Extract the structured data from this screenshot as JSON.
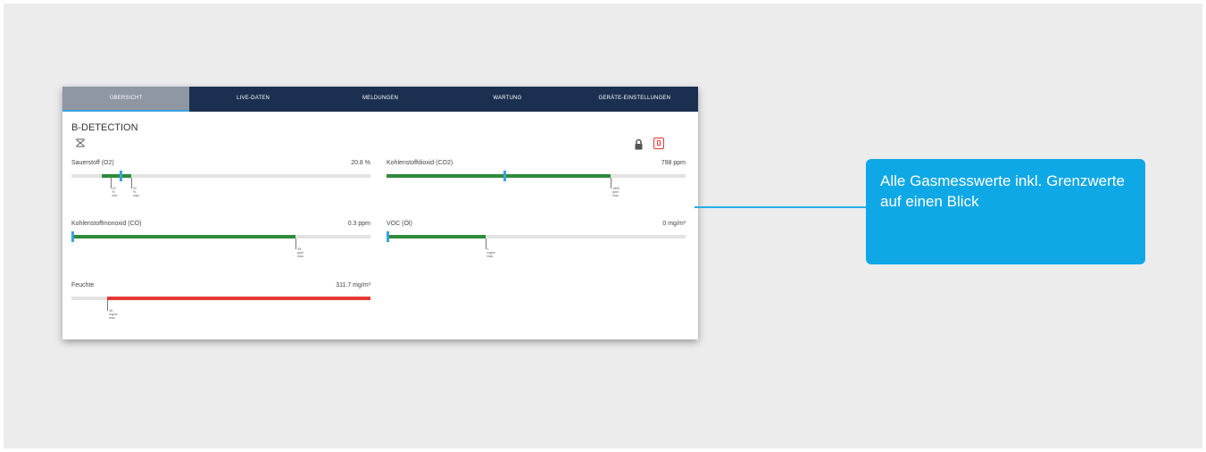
{
  "tabs": [
    {
      "label": "ÜBERSICHT",
      "active": true
    },
    {
      "label": "LIVE-DATEN",
      "active": false
    },
    {
      "label": "MELDUNGEN",
      "active": false
    },
    {
      "label": "WARTUNG",
      "active": false
    },
    {
      "label": "GERÄTE-EINSTELLUNGEN",
      "active": false
    }
  ],
  "device": {
    "title": "B-DETECTION"
  },
  "icons": {
    "sensor": "sensor-icon",
    "lock": "lock-icon",
    "alarm": "alarm-icon"
  },
  "colors": {
    "nav": "#1b3050",
    "ok": "#2e8b3a",
    "alarm": "#e53935",
    "marker": "#3aa3dd",
    "callout": "#0fa8e6"
  },
  "gauges": [
    {
      "label": "Sauerstoff (O2)",
      "value": "20.8 %",
      "level_pct": 16,
      "bar_from_pct": 10,
      "bar_to_pct": 20,
      "status": "ok",
      "thresholds": [
        {
          "pos_pct": 13,
          "lines": [
            "23",
            "%",
            "min."
          ]
        },
        {
          "pos_pct": 20,
          "lines": [
            "22",
            "%",
            "max."
          ]
        }
      ]
    },
    {
      "label": "Kohlenstoffdioxid (CO2)",
      "value": "798 ppm",
      "level_pct": 39,
      "bar_from_pct": 0,
      "bar_to_pct": 75,
      "status": "ok",
      "thresholds": [
        {
          "pos_pct": 75,
          "lines": [
            "1500",
            "ppm",
            "max."
          ]
        }
      ]
    },
    {
      "label": "Kohlenstoffmonoxid (CO)",
      "value": "0.3 ppm",
      "level_pct": 0,
      "bar_from_pct": 0,
      "bar_to_pct": 75,
      "status": "ok",
      "thresholds": [
        {
          "pos_pct": 75,
          "lines": [
            "35",
            "ppm",
            "max."
          ]
        }
      ]
    },
    {
      "label": "VOC (Öl)",
      "value": "0 mg/m³",
      "level_pct": 0,
      "bar_from_pct": 0,
      "bar_to_pct": 33,
      "status": "ok",
      "thresholds": [
        {
          "pos_pct": 33,
          "lines": [
            "1",
            "mg/m³",
            "max."
          ]
        }
      ]
    },
    {
      "label": "Feuchte",
      "value": "311.7 mg/m³",
      "level_pct": 100,
      "bar_from_pct": 12,
      "bar_to_pct": 100,
      "status": "alarm",
      "thresholds": [
        {
          "pos_pct": 12,
          "lines": [
            "25",
            "mg/m³",
            "max."
          ]
        }
      ]
    }
  ],
  "callout": {
    "text": "Alle Gasmesswerte inkl. Grenzwerte auf einen Blick"
  }
}
